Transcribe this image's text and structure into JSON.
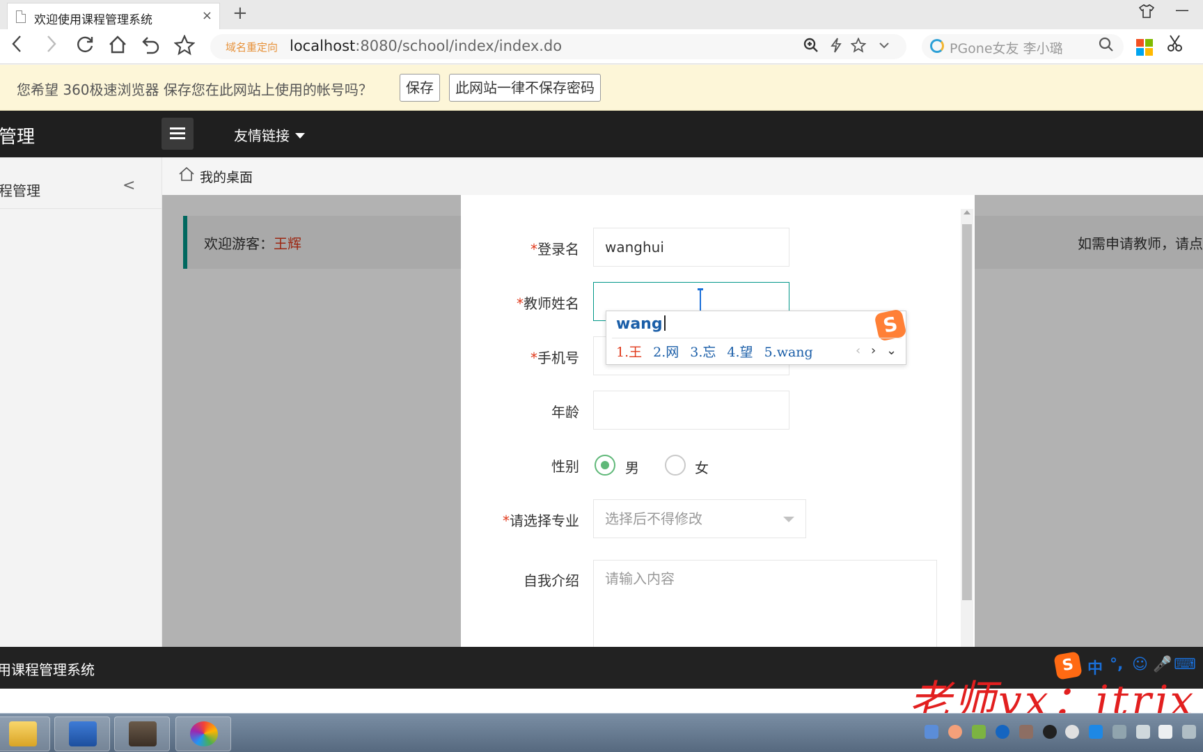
{
  "browser": {
    "tab_title": "欢迎使用课程管理系统",
    "tab_close": "×",
    "new_tab": "+",
    "redirect_label": "域名重定向",
    "url_host": "localhost",
    "url_rest": ":8080/school/index/index.do",
    "search_text": "PGone女友 李小璐",
    "icons": [
      "back-icon",
      "forward-icon",
      "refresh-icon",
      "home-icon",
      "undo-icon",
      "star-icon",
      "zoom-icon",
      "lightning-icon",
      "bookmark-icon",
      "dropdown-icon",
      "search-icon",
      "apps-icon",
      "scissors-icon",
      "shirt-icon",
      "minimize-icon"
    ]
  },
  "password_bar": {
    "message": "您希望 360极速浏览器 保存您在此网站上使用的帐号吗？",
    "save_label": "保存",
    "never_label": "此网站一律不保存密码"
  },
  "header": {
    "title_fragment": "管理",
    "friend_links": "友情链接"
  },
  "sidebar": {
    "item_label": "程管理",
    "arrow": "<"
  },
  "breadcrumb": {
    "label": "我的桌面"
  },
  "welcome": {
    "prefix": "欢迎游客：",
    "name": "王辉",
    "right_text": "如需申请教师，请点"
  },
  "form": {
    "login_label": "登录名",
    "login_value": "wanghui",
    "name_label": "教师姓名",
    "name_value": "",
    "phone_label": "手机号",
    "age_label": "年龄",
    "gender_label": "性别",
    "gender_male": "男",
    "gender_female": "女",
    "gender_selected": "男",
    "major_label": "请选择专业",
    "major_placeholder": "选择后不得修改",
    "intro_label": "自我介绍",
    "intro_placeholder": "请输入内容",
    "required_mark": "*"
  },
  "ime": {
    "input": "wang",
    "candidates": [
      "1.王",
      "2.网",
      "3.忘",
      "4.望",
      "5.wang"
    ],
    "prev": "‹",
    "next": "›",
    "more": "⌄",
    "logo": "S",
    "status_items": [
      "中",
      "°,",
      "☺",
      "🎤",
      "⌨"
    ]
  },
  "footer": {
    "text": "用课程管理系统"
  },
  "watermark": "老师vx：itrjx",
  "colors": {
    "accent": "#009688",
    "required": "#e0391b",
    "radio_on": "#5fb878",
    "header_bg": "#1f1f1f"
  }
}
